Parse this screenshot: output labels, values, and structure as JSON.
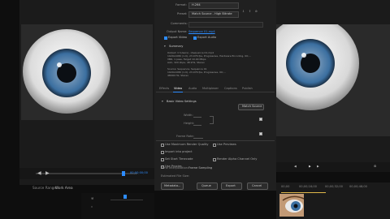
{
  "colors": {
    "app_bg": "#0e0e0e",
    "panel_bg": "#1b1b1b",
    "dialog_bg": "#202020",
    "accent": "#2d8cff",
    "playhead": "#e0b84a",
    "iris": "#3b6fa0"
  },
  "dialog": {
    "format_label": "Format:",
    "format_value": "H.264",
    "preset_label": "Preset:",
    "preset_value": "Match Source - High Bitrate",
    "comments_label": "Comments:",
    "output_name_label": "Output Name:",
    "output_name_value": "Sequence 01.mp4",
    "export_video_label": "Export Video",
    "export_audio_label": "Export Audio",
    "summary_heading": "Summary",
    "summary_output_text": "Output: C:\\Users\\...\\Sequence 01.mp4\n1920x1080 (1.0), 23.976 fps, Progressive, Hardware Encoding, 00;...\nVBR, 1 pass, Target 10.00 Mbps\nAAC, 320 kbps, 48 kHz, Stereo",
    "summary_source_text": "Source: Sequence, Sequence 01\n1920x1080 (1.0), 23.976 fps, Progressive, 00;...\n48000 Hz, Stereo",
    "tabs": [
      "Effects",
      "Video",
      "Audio",
      "Multiplexer",
      "Captions",
      "Publish"
    ],
    "active_tab_index": 1,
    "basic_video_settings_heading": "Basic Video Settings",
    "match_source_button": "Match Source",
    "width_label": "Width:",
    "height_label": "Height:",
    "frame_rate_label": "Frame Rate:",
    "options": [
      "Use Maximum Render Quality",
      "Use Previews",
      "Import into project",
      "Set Start Timecode",
      "Use Proxies",
      "Render Alpha Channel Only"
    ],
    "time_interpolation_label": "Time Interpolation:",
    "time_interpolation_value": "Frame Sampling",
    "estimated_file_size_label": "Estimated File Size:",
    "buttons": [
      "Metadata...",
      "Queue",
      "Export",
      "Cancel"
    ]
  },
  "source_monitor": {
    "timecode": "00;00;00;00",
    "fit_label": "Fit",
    "source_range_label": "Source Range:",
    "source_range_value": "Work Area"
  },
  "timeline": {
    "timecodes": [
      "00;00",
      "00;00;16;00",
      "00;00;32;00",
      "00;00;48;00"
    ]
  },
  "icons": [
    "folder-icon",
    "upload-icon",
    "settings-icon",
    "chevron-down-icon",
    "play-icon",
    "step-forward-icon",
    "step-back-icon",
    "wrench-icon",
    "crop-icon"
  ]
}
